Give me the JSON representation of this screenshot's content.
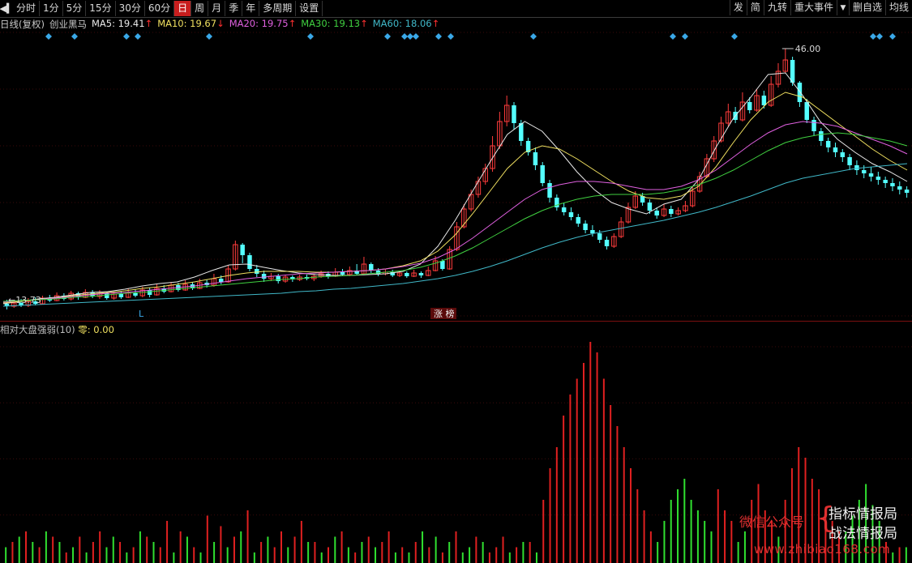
{
  "toolbar": {
    "back_icon": "play-back-icon",
    "periods": [
      "分时",
      "1分",
      "5分",
      "15分",
      "30分",
      "60分",
      "日",
      "周",
      "月",
      "季",
      "年",
      "多周期",
      "设置"
    ],
    "active_index": 6,
    "right": [
      "发",
      "简",
      "九转",
      "重大事件"
    ],
    "right2": [
      "删自选",
      "均线"
    ],
    "dropdown_icon": "triangle-down-icon"
  },
  "legend": {
    "prefix": "日线(复权)",
    "stock_name": "创业黑马",
    "mas": [
      {
        "label": "MA5: 19.41",
        "arrow": "↑",
        "color": "#e8e8e8"
      },
      {
        "label": "MA10: 19.67",
        "arrow": "↓",
        "color": "#f0e060"
      },
      {
        "label": "MA20: 19.75",
        "arrow": "↑",
        "color": "#e060e0"
      },
      {
        "label": "MA30: 19.13",
        "arrow": "↑",
        "color": "#40d040"
      },
      {
        "label": "MA60: 18.06",
        "arrow": "↑",
        "color": "#40b8c8"
      }
    ],
    "arrow_color": "#ff3030"
  },
  "price_panel": {
    "high_label": "46.00",
    "low_label": "13.73",
    "marker_l": "L",
    "marker_limit": "涨 榜",
    "colors": {
      "up": "#ff3c3c",
      "down": "#54ffff"
    }
  },
  "indicator": {
    "name": "相对大盘强弱(10)",
    "zero_label": "零: 0.00",
    "name_color": "#bcbcbc",
    "zero_color": "#f0e060",
    "colors": {
      "pos": "#e02020",
      "neg": "#30e030"
    }
  },
  "watermark": {
    "line_a": "微信公众号",
    "line_b": "指标情报局",
    "line_c": "战法情报局",
    "url": "www.zhibiao168.com"
  },
  "chart_data": {
    "type": "candlestick",
    "ylim": [
      13,
      48
    ],
    "candles": [
      [
        14.5,
        14.2,
        15.0,
        13.8
      ],
      [
        14.2,
        14.6,
        14.9,
        14.0
      ],
      [
        14.6,
        14.3,
        15.1,
        14.1
      ],
      [
        14.3,
        14.8,
        15.2,
        14.1
      ],
      [
        14.8,
        14.5,
        15.3,
        14.3
      ],
      [
        14.5,
        15.2,
        15.5,
        14.4
      ],
      [
        15.2,
        14.9,
        15.6,
        14.7
      ],
      [
        14.9,
        15.5,
        15.9,
        14.8
      ],
      [
        15.5,
        15.1,
        15.8,
        14.9
      ],
      [
        15.1,
        15.8,
        16.1,
        14.9
      ],
      [
        15.8,
        15.3,
        16.0,
        15.0
      ],
      [
        15.3,
        15.9,
        16.3,
        15.2
      ],
      [
        15.9,
        15.4,
        16.2,
        15.2
      ],
      [
        15.4,
        15.8,
        16.2,
        15.1
      ],
      [
        15.8,
        15.2,
        16.0,
        15.0
      ],
      [
        15.2,
        15.7,
        16.0,
        15.0
      ],
      [
        15.7,
        15.3,
        16.1,
        15.1
      ],
      [
        15.3,
        15.9,
        16.4,
        15.2
      ],
      [
        15.9,
        15.5,
        16.3,
        15.3
      ],
      [
        15.5,
        16.2,
        16.6,
        15.3
      ],
      [
        16.2,
        15.6,
        16.5,
        15.3
      ],
      [
        15.6,
        16.4,
        16.9,
        15.5
      ],
      [
        16.4,
        16.0,
        16.8,
        15.8
      ],
      [
        16.0,
        16.8,
        17.2,
        15.9
      ],
      [
        16.8,
        16.2,
        17.1,
        16.0
      ],
      [
        16.2,
        16.9,
        17.4,
        16.1
      ],
      [
        16.9,
        16.4,
        17.2,
        16.2
      ],
      [
        16.4,
        17.1,
        17.6,
        16.3
      ],
      [
        17.1,
        16.8,
        17.5,
        16.5
      ],
      [
        16.8,
        17.6,
        18.2,
        16.6
      ],
      [
        17.6,
        17.2,
        18.0,
        16.9
      ],
      [
        17.2,
        18.8,
        19.2,
        17.1
      ],
      [
        18.8,
        21.8,
        22.3,
        18.6
      ],
      [
        21.8,
        20.5,
        22.0,
        19.5
      ],
      [
        20.5,
        18.8,
        20.8,
        18.5
      ],
      [
        18.8,
        18.2,
        19.3,
        17.8
      ],
      [
        18.2,
        17.6,
        18.6,
        17.2
      ],
      [
        17.6,
        17.9,
        18.3,
        17.3
      ],
      [
        17.9,
        17.3,
        18.2,
        17.0
      ],
      [
        17.3,
        17.8,
        18.1,
        17.1
      ],
      [
        17.8,
        17.5,
        18.0,
        17.2
      ],
      [
        17.5,
        17.8,
        18.1,
        17.3
      ],
      [
        17.8,
        17.6,
        18.1,
        17.4
      ],
      [
        17.6,
        17.9,
        18.2,
        17.3
      ],
      [
        17.9,
        18.2,
        18.6,
        17.7
      ],
      [
        18.2,
        17.9,
        18.5,
        17.6
      ],
      [
        17.9,
        18.4,
        18.9,
        17.8
      ],
      [
        18.4,
        18.1,
        18.8,
        17.9
      ],
      [
        18.1,
        18.6,
        19.1,
        17.9
      ],
      [
        18.6,
        18.2,
        19.4,
        18.0
      ],
      [
        18.2,
        19.4,
        20.3,
        18.1
      ],
      [
        19.4,
        18.6,
        19.6,
        18.3
      ],
      [
        18.6,
        18.2,
        18.9,
        17.9
      ],
      [
        18.2,
        18.4,
        18.8,
        18.0
      ],
      [
        18.4,
        18.0,
        18.7,
        17.8
      ],
      [
        18.0,
        18.3,
        18.6,
        17.8
      ],
      [
        18.3,
        17.9,
        18.5,
        17.7
      ],
      [
        17.9,
        18.3,
        18.7,
        17.8
      ],
      [
        18.3,
        18.0,
        18.5,
        17.7
      ],
      [
        18.0,
        18.6,
        19.1,
        17.9
      ],
      [
        18.6,
        19.8,
        20.4,
        18.5
      ],
      [
        19.8,
        18.8,
        20.0,
        18.6
      ],
      [
        18.8,
        21.2,
        21.6,
        18.7
      ],
      [
        21.2,
        24.0,
        24.6,
        21.0
      ],
      [
        24.0,
        26.2,
        26.8,
        23.8
      ],
      [
        26.2,
        28.0,
        28.6,
        25.9
      ],
      [
        28.0,
        29.6,
        30.2,
        27.6
      ],
      [
        29.6,
        31.2,
        31.8,
        29.2
      ],
      [
        31.2,
        34.0,
        35.2,
        30.8
      ],
      [
        34.0,
        37.0,
        38.2,
        33.6
      ],
      [
        37.0,
        39.0,
        40.2,
        36.4
      ],
      [
        39.0,
        36.8,
        39.4,
        36.0
      ],
      [
        36.8,
        34.6,
        37.2,
        34.0
      ],
      [
        34.6,
        33.2,
        35.0,
        32.8
      ],
      [
        33.2,
        31.6,
        33.8,
        31.0
      ],
      [
        31.6,
        29.4,
        32.0,
        29.0
      ],
      [
        29.4,
        27.6,
        29.8,
        27.0
      ],
      [
        27.6,
        26.4,
        28.0,
        26.0
      ],
      [
        26.4,
        25.8,
        27.0,
        25.4
      ],
      [
        25.8,
        25.2,
        26.4,
        24.8
      ],
      [
        25.2,
        24.4,
        25.6,
        24.0
      ],
      [
        24.4,
        23.6,
        24.8,
        23.2
      ],
      [
        23.6,
        23.2,
        24.2,
        22.8
      ],
      [
        23.2,
        22.4,
        23.6,
        22.0
      ],
      [
        22.4,
        21.6,
        22.8,
        21.2
      ],
      [
        21.6,
        22.8,
        23.2,
        21.4
      ],
      [
        22.8,
        24.6,
        25.2,
        22.6
      ],
      [
        24.6,
        26.4,
        27.0,
        24.4
      ],
      [
        26.4,
        27.8,
        28.4,
        26.2
      ],
      [
        27.8,
        27.0,
        28.2,
        26.6
      ],
      [
        27.0,
        26.0,
        27.4,
        25.6
      ],
      [
        26.0,
        25.4,
        26.4,
        25.0
      ],
      [
        25.4,
        26.2,
        26.8,
        25.2
      ],
      [
        26.2,
        25.6,
        26.6,
        25.2
      ],
      [
        25.6,
        26.0,
        26.4,
        25.4
      ],
      [
        26.0,
        26.6,
        27.2,
        25.8
      ],
      [
        26.6,
        28.4,
        29.0,
        26.4
      ],
      [
        28.4,
        30.2,
        30.8,
        28.2
      ],
      [
        30.2,
        32.4,
        33.0,
        30.0
      ],
      [
        32.4,
        34.6,
        35.2,
        32.0
      ],
      [
        34.6,
        36.8,
        37.6,
        34.4
      ],
      [
        36.8,
        38.2,
        39.2,
        36.4
      ],
      [
        38.2,
        37.2,
        38.8,
        36.8
      ],
      [
        37.2,
        39.4,
        40.6,
        37.0
      ],
      [
        39.4,
        38.4,
        40.0,
        38.0
      ],
      [
        38.4,
        40.2,
        41.0,
        38.2
      ],
      [
        40.2,
        39.0,
        40.8,
        38.6
      ],
      [
        39.0,
        41.6,
        42.6,
        38.8
      ],
      [
        41.6,
        43.2,
        44.2,
        41.2
      ],
      [
        43.2,
        44.6,
        46.0,
        43.0
      ],
      [
        44.6,
        41.8,
        45.0,
        41.4
      ],
      [
        41.8,
        39.4,
        42.0,
        38.8
      ],
      [
        39.4,
        37.2,
        39.8,
        36.8
      ],
      [
        37.2,
        35.8,
        37.6,
        35.2
      ],
      [
        35.8,
        34.6,
        36.2,
        34.0
      ],
      [
        34.6,
        33.8,
        35.0,
        33.2
      ],
      [
        33.8,
        33.2,
        34.4,
        32.6
      ],
      [
        33.2,
        32.6,
        33.6,
        32.0
      ],
      [
        32.6,
        31.6,
        33.0,
        31.0
      ],
      [
        31.6,
        31.0,
        32.2,
        30.4
      ],
      [
        31.0,
        30.6,
        31.6,
        30.0
      ],
      [
        30.6,
        30.2,
        31.4,
        29.6
      ],
      [
        30.2,
        29.8,
        30.8,
        29.2
      ],
      [
        29.8,
        29.4,
        30.2,
        28.8
      ],
      [
        29.4,
        29.0,
        30.0,
        28.4
      ],
      [
        29.0,
        28.6,
        29.6,
        28.0
      ],
      [
        28.6,
        28.2,
        29.0,
        27.6
      ]
    ],
    "ma_lines": {
      "ma5": [
        14.5,
        14.8,
        15.1,
        15.3,
        15.6,
        15.9,
        16.0,
        16.3,
        16.7,
        17.0,
        17.2,
        17.8,
        18.6,
        19.3,
        19.4,
        19.0,
        18.6,
        18.3,
        18.1,
        18.0,
        18.0,
        18.1,
        18.2,
        18.5,
        19.4,
        21.6,
        24.8,
        28.4,
        32.0,
        35.4,
        37.0,
        35.8,
        33.4,
        30.8,
        28.6,
        27.0,
        26.2,
        25.6,
        26.8,
        27.4,
        29.8,
        33.8,
        37.4,
        40.0,
        42.8,
        43.0,
        40.2,
        37.0,
        34.8,
        33.2,
        31.8,
        30.8,
        29.6
      ],
      "ma10": [
        14.6,
        14.8,
        15.0,
        15.2,
        15.5,
        15.7,
        15.9,
        16.1,
        16.4,
        16.6,
        16.9,
        17.2,
        17.6,
        18.0,
        18.3,
        18.5,
        18.5,
        18.5,
        18.4,
        18.4,
        18.5,
        18.6,
        18.8,
        19.2,
        19.8,
        21.0,
        23.0,
        25.6,
        28.4,
        31.2,
        33.2,
        34.0,
        33.6,
        32.4,
        31.0,
        29.6,
        28.4,
        27.6,
        27.4,
        27.8,
        29.0,
        31.4,
        34.4,
        37.2,
        39.4,
        40.6,
        40.0,
        38.4,
        36.8,
        35.2,
        33.6,
        32.2,
        31.0
      ],
      "ma20": [
        14.7,
        14.9,
        15.0,
        15.2,
        15.4,
        15.6,
        15.8,
        15.9,
        16.1,
        16.3,
        16.5,
        16.7,
        17.0,
        17.3,
        17.6,
        17.8,
        18.0,
        18.2,
        18.3,
        18.4,
        18.5,
        18.6,
        18.8,
        19.1,
        19.5,
        20.2,
        21.2,
        22.6,
        24.2,
        25.8,
        27.4,
        28.6,
        29.2,
        29.6,
        29.6,
        29.4,
        29.0,
        28.6,
        28.6,
        29.0,
        29.8,
        31.0,
        32.6,
        34.2,
        35.6,
        36.6,
        37.0,
        36.8,
        36.4,
        35.6,
        34.8,
        34.0,
        33.0
      ],
      "ma30": [
        14.8,
        14.9,
        15.0,
        15.1,
        15.3,
        15.4,
        15.6,
        15.8,
        15.9,
        16.1,
        16.3,
        16.5,
        16.7,
        16.9,
        17.1,
        17.3,
        17.5,
        17.6,
        17.8,
        17.9,
        18.0,
        18.2,
        18.4,
        18.6,
        19.0,
        19.6,
        20.4,
        21.4,
        22.6,
        23.8,
        25.0,
        26.0,
        26.8,
        27.4,
        27.8,
        28.0,
        28.0,
        28.0,
        28.2,
        28.6,
        29.2,
        30.0,
        31.0,
        32.2,
        33.4,
        34.4,
        35.0,
        35.4,
        35.6,
        35.4,
        35.0,
        34.6,
        34.0
      ],
      "ma60": [
        14.2,
        14.3,
        14.4,
        14.5,
        14.6,
        14.7,
        14.8,
        14.9,
        15.0,
        15.1,
        15.2,
        15.3,
        15.4,
        15.5,
        15.6,
        15.7,
        15.8,
        16.0,
        16.1,
        16.3,
        16.4,
        16.6,
        16.8,
        17.0,
        17.3,
        17.6,
        18.0,
        18.5,
        19.1,
        19.8,
        20.6,
        21.4,
        22.1,
        22.7,
        23.2,
        23.6,
        24.0,
        24.4,
        24.8,
        25.3,
        25.8,
        26.4,
        27.1,
        27.8,
        28.6,
        29.4,
        30.0,
        30.4,
        30.8,
        31.2,
        31.4,
        31.6,
        31.8
      ]
    },
    "indicator_bars": [
      -3,
      4,
      -5,
      6,
      -4,
      3,
      -6,
      5,
      -4,
      2,
      -3,
      5,
      -2,
      4,
      6,
      -3,
      -5,
      4,
      -2,
      3,
      -6,
      5,
      -4,
      3,
      8,
      -2,
      6,
      -5,
      3,
      -2,
      9,
      -4,
      7,
      -3,
      5,
      -6,
      10,
      -2,
      4,
      -5,
      3,
      6,
      -3,
      5,
      8,
      -4,
      4,
      -2,
      3,
      -5,
      6,
      -3,
      2,
      -4,
      5,
      -3,
      4,
      6,
      -2,
      3,
      -2,
      4,
      -6,
      3,
      -5,
      2,
      -4,
      6,
      -2,
      -3,
      5,
      -4,
      2,
      3,
      5,
      -2,
      3,
      -4,
      4,
      -2,
      12,
      18,
      22,
      28,
      32,
      35,
      38,
      42,
      40,
      35,
      30,
      26,
      22,
      18,
      14,
      10,
      6,
      -4,
      -8,
      -12,
      -14,
      -16,
      -12,
      -10,
      -8,
      -6,
      14,
      10,
      8,
      -4,
      -6,
      12,
      15,
      10,
      8,
      -5,
      12,
      18,
      22,
      20,
      16,
      14,
      10,
      8,
      6,
      -6,
      -9,
      -12,
      -15,
      -11,
      -8,
      4,
      -2,
      3,
      -3
    ],
    "indicator_ylim": [
      -40,
      60
    ]
  }
}
